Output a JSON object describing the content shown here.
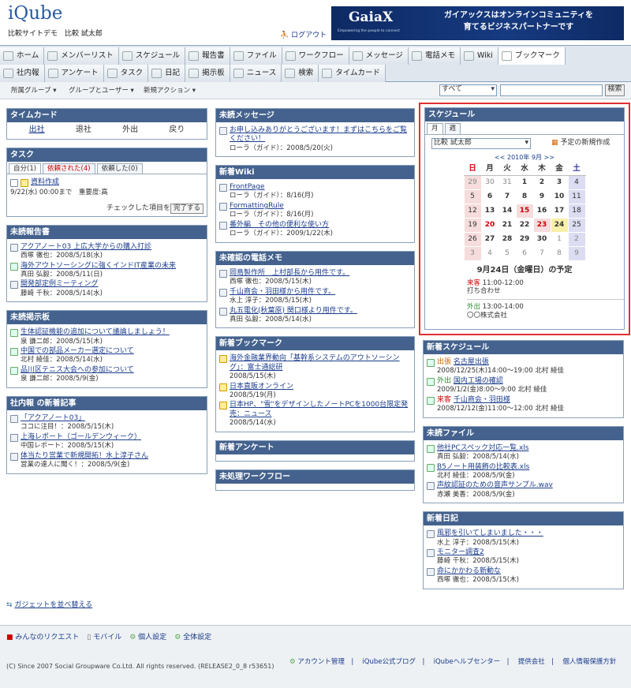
{
  "header": {
    "logo": "iQube",
    "site": "比較サイトデモ　比較 試太郎",
    "logout": "ログアウト"
  },
  "banner": {
    "logo": "GaiaX",
    "slogan": "Empowering the people to connect",
    "text1": "ガイアックスはオンラインコミュニティを",
    "text2": "育てるビジネスパートナーです"
  },
  "nav": {
    "row1": [
      "ホーム",
      "メンバーリスト",
      "スケジュール",
      "報告書",
      "ファイル",
      "ワークフロー",
      "メッセージ",
      "電話メモ",
      "Wiki",
      "ブックマーク"
    ],
    "row2": [
      "社内報",
      "アンケート",
      "タスク",
      "日記",
      "掲示板",
      "ニュース",
      "検索",
      "タイムカード"
    ]
  },
  "subbar": {
    "group": "所属グループ ▾",
    "groups_users": "グループとユーザー ▾",
    "new_action": "新規アクション ▾",
    "scope": "すべて",
    "search_btn": "検索"
  },
  "timecard": {
    "title": "タイムカード",
    "buttons": [
      "出社",
      "退社",
      "外出",
      "戻り"
    ]
  },
  "task": {
    "title": "タスク",
    "tabs": [
      "自分(1)",
      "依頼された(4)",
      "依頼した(0)"
    ],
    "item": "資料作成",
    "due": "9/22(水) 00:00まで　重要度:高",
    "check_label": "チェックした項目を",
    "complete": "完了する"
  },
  "unread_reports": {
    "title": "未読報告書",
    "items": [
      {
        "t": "アクアノート03 上広大学からの購入打診",
        "m": "西塚 徹也：2008/5/18(水)"
      },
      {
        "t": "海外アウトソーシングに強くインドIT産業の未来",
        "m": "真田 弘毅：2008/5/11(日)"
      },
      {
        "t": "開発部定例ミーティング",
        "m": "藤崎 千秋：2008/5/14(水)"
      }
    ]
  },
  "unread_bbs": {
    "title": "未読掲示板",
    "items": [
      {
        "t": "生体認証機能の追加について議論しましょう！",
        "m": "泉 謙二郎：2008/5/15(木)"
      },
      {
        "t": "中国での部品メーカー選定について",
        "m": "北村 綾佳：2008/5/14(水)"
      },
      {
        "t": "品川区テニス大会への参加について",
        "m": "泉 謙二郎：2008/5/9(金)"
      }
    ]
  },
  "bulletin": {
    "title": "社内報 の新着記事",
    "items": [
      {
        "t": "「アクアノート03」",
        "m": "ココに注目！：2008/5/15(木)"
      },
      {
        "t": "上海レポート（ゴールデンウィーク）",
        "m": "中国レポート：2008/5/15(木)"
      },
      {
        "t": "体当たり営業で新規開拓！水上淳子さん",
        "m": "営業の達人に聞く！：2008/5/9(金)"
      }
    ]
  },
  "unread_msg": {
    "title": "未読メッセージ",
    "item": "お申し込みありがとうございます！まずはこちらをご覧ください！",
    "meta": "ローラ（ガイド）：2008/5/20(火)"
  },
  "wiki": {
    "title": "新着Wiki",
    "items": [
      {
        "t": "FrontPage",
        "m": "ローラ（ガイド）：8/16(月)"
      },
      {
        "t": "FormattingRule",
        "m": "ローラ（ガイド）：8/16(月)"
      },
      {
        "t": "番外編　その他の便利な使い方",
        "m": "ローラ（ガイド）：2009/1/22(木)"
      }
    ]
  },
  "phone": {
    "title": "未確認の電話メモ",
    "items": [
      {
        "t": "岡島製作所　上村部長から用件です。",
        "m": "西塚 徹也：2008/5/15(木)"
      },
      {
        "t": "千山商会・羽田様から用件です。",
        "m": "水上 淳子：2008/5/15(木)"
      },
      {
        "t": "丸五電化(秋葉原) 関口様より用件です。",
        "m": "真田 弘毅：2008/5/14(水)"
      }
    ]
  },
  "bookmark": {
    "title": "新着ブックマーク",
    "items": [
      {
        "t": "海外金融業界動向「基幹系システムのアウトソーシング」：富士通総研",
        "m": "2008/5/15(木)"
      },
      {
        "t": "日本直販オンライン",
        "m": "2008/5/19(月)"
      },
      {
        "t": "日本HP、\"雪\"をデザインしたノートPCを1000台限定発売：ニュース",
        "m": "2008/5/14(水)"
      }
    ]
  },
  "enquete": {
    "title": "新着アンケート"
  },
  "workflow": {
    "title": "未処理ワークフロー"
  },
  "schedule": {
    "title": "スケジュール",
    "tabs": [
      "月",
      "週"
    ],
    "user": "比較 試太郎",
    "new_link": "予定の新規作成",
    "month_label": "<< 2010年 9月 >>",
    "weekdays": [
      "日",
      "月",
      "火",
      "水",
      "木",
      "金",
      "土"
    ],
    "weeks": [
      [
        "29",
        "30",
        "31",
        "1",
        "2",
        "3",
        "4"
      ],
      [
        "5",
        "6",
        "7",
        "8",
        "9",
        "10",
        "11"
      ],
      [
        "12",
        "13",
        "14",
        "15",
        "16",
        "17",
        "18"
      ],
      [
        "19",
        "20",
        "21",
        "22",
        "23",
        "24",
        "25"
      ],
      [
        "26",
        "27",
        "28",
        "29",
        "30",
        "1",
        "2"
      ],
      [
        "3",
        "4",
        "5",
        "6",
        "7",
        "8",
        "9"
      ]
    ],
    "day_title": "9月24日（金曜日）の予定",
    "events": [
      {
        "cat": "来客",
        "time": "11:00-12:00",
        "desc": "打ち合わせ"
      },
      {
        "cat": "外出",
        "time": "13:00-14:00",
        "desc": "〇〇株式会社"
      }
    ]
  },
  "new_sched": {
    "title": "新着スケジュール",
    "items": [
      {
        "tag": "出張",
        "t": "名古屋出張",
        "m": "2008/12/25(木)14:00～19:00 北村 綾佳"
      },
      {
        "tag": "外出",
        "t": "国内工場の確認",
        "m": "2009/1/2(金)8:00～9:00 北村 綾佳"
      },
      {
        "tag": "来客",
        "t": "千山商会・羽田様",
        "m": "2008/12/12(金)11:00～12:00 北村 綾佳"
      }
    ]
  },
  "files": {
    "title": "未読ファイル",
    "items": [
      {
        "t": "他社PCスペック対応一覧.xls",
        "m": "真田 弘毅：2008/5/14(水)"
      },
      {
        "t": "B5ノート用装飾の比較表.xls",
        "m": "北村 綾佳：2008/5/9(金)"
      },
      {
        "t": "声紋認証のための音声サンプル.wav",
        "m": "赤瀬 美香：2008/5/9(金)"
      }
    ]
  },
  "diary": {
    "title": "新着日記",
    "items": [
      {
        "t": "風邪を引いてしまいました・・・",
        "m": "水上 淳子：2008/5/15(木)"
      },
      {
        "t": "モニター調査2",
        "m": "藤崎 千秋：2008/5/15(木)"
      },
      {
        "t": "命にかかわる新動な",
        "m": "西塚 徹也：2008/5/15(木)"
      }
    ]
  },
  "arrange": "ガジェットを並べ替える",
  "footer": {
    "links": [
      "みんなのリクエスト",
      "モバイル",
      "個人設定",
      "全体設定"
    ],
    "copyright": "(C) Since 2007 Social Groupware Co.Ltd. All rights reserved. (RELEASE2_0_8 r53651)",
    "right": [
      "アカウント管理",
      "iQube公式ブログ",
      "iQubeヘルプセンター",
      "提供会社",
      "個人情報保護方針"
    ]
  }
}
